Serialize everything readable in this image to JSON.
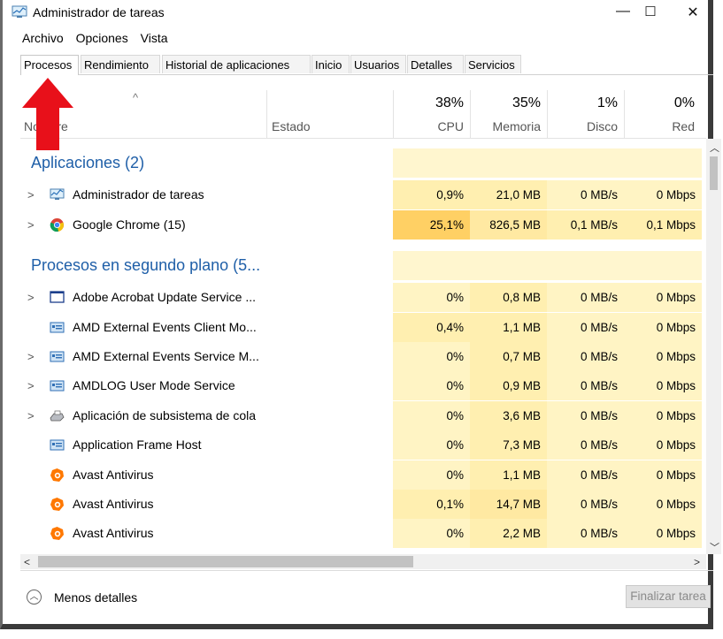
{
  "window": {
    "title": "Administrador de tareas",
    "minimize_glyph": "—",
    "maximize_glyph": "☐",
    "close_glyph": "✕"
  },
  "menu": [
    "Archivo",
    "Opciones",
    "Vista"
  ],
  "tabs": [
    "Procesos",
    "Rendimiento",
    "Historial de aplicaciones",
    "Inicio",
    "Usuarios",
    "Detalles",
    "Servicios"
  ],
  "columns": {
    "name": "Nombre",
    "status": "Estado",
    "cpu": {
      "percent": "38%",
      "label": "CPU"
    },
    "memory": {
      "percent": "35%",
      "label": "Memoria"
    },
    "disk": {
      "percent": "1%",
      "label": "Disco"
    },
    "network": {
      "percent": "0%",
      "label": "Red"
    }
  },
  "groups": [
    {
      "title": "Aplicaciones (2)",
      "rows": [
        {
          "name": "Administrador de tareas",
          "icon": "task-manager-icon",
          "expandable": true,
          "cpu": "0,9%",
          "memory": "21,0 MB",
          "disk": "0 MB/s",
          "network": "0 Mbps"
        },
        {
          "name": "Google Chrome (15)",
          "icon": "chrome-icon",
          "expandable": true,
          "cpu": "25,1%",
          "memory": "826,5 MB",
          "disk": "0,1 MB/s",
          "network": "0,1 Mbps"
        }
      ]
    },
    {
      "title": "Procesos en segundo plano (5...",
      "rows": [
        {
          "name": "Adobe Acrobat Update Service ...",
          "icon": "window-icon",
          "expandable": true,
          "cpu": "0%",
          "memory": "0,8 MB",
          "disk": "0 MB/s",
          "network": "0 Mbps"
        },
        {
          "name": "AMD External Events Client Mo...",
          "icon": "service-icon",
          "expandable": false,
          "cpu": "0,4%",
          "memory": "1,1 MB",
          "disk": "0 MB/s",
          "network": "0 Mbps"
        },
        {
          "name": "AMD External Events Service M...",
          "icon": "service-icon",
          "expandable": true,
          "cpu": "0%",
          "memory": "0,7 MB",
          "disk": "0 MB/s",
          "network": "0 Mbps"
        },
        {
          "name": "AMDLOG User Mode Service",
          "icon": "service-icon",
          "expandable": true,
          "cpu": "0%",
          "memory": "0,9 MB",
          "disk": "0 MB/s",
          "network": "0 Mbps"
        },
        {
          "name": "Aplicación de subsistema de cola",
          "icon": "printer-icon",
          "expandable": true,
          "cpu": "0%",
          "memory": "3,6 MB",
          "disk": "0 MB/s",
          "network": "0 Mbps"
        },
        {
          "name": "Application Frame Host",
          "icon": "service-icon",
          "expandable": false,
          "cpu": "0%",
          "memory": "7,3 MB",
          "disk": "0 MB/s",
          "network": "0 Mbps"
        },
        {
          "name": "Avast Antivirus",
          "icon": "avast-icon",
          "expandable": false,
          "cpu": "0%",
          "memory": "1,1 MB",
          "disk": "0 MB/s",
          "network": "0 Mbps"
        },
        {
          "name": "Avast Antivirus",
          "icon": "avast-icon",
          "expandable": false,
          "cpu": "0,1%",
          "memory": "14,7 MB",
          "disk": "0 MB/s",
          "network": "0 Mbps"
        },
        {
          "name": "Avast Antivirus",
          "icon": "avast-icon",
          "expandable": false,
          "cpu": "0%",
          "memory": "2,2 MB",
          "disk": "0 MB/s",
          "network": "0 Mbps"
        }
      ]
    }
  ],
  "footer": {
    "less_details": "Menos detalles",
    "end_task": "Finalizar tarea"
  },
  "colors": {
    "heat_light": "#fff4c4",
    "heat_medium": "#ffe9a2",
    "heat_high": "#ffd064",
    "group_title": "#1f5fa8",
    "annotation_arrow": "#e8101a"
  }
}
